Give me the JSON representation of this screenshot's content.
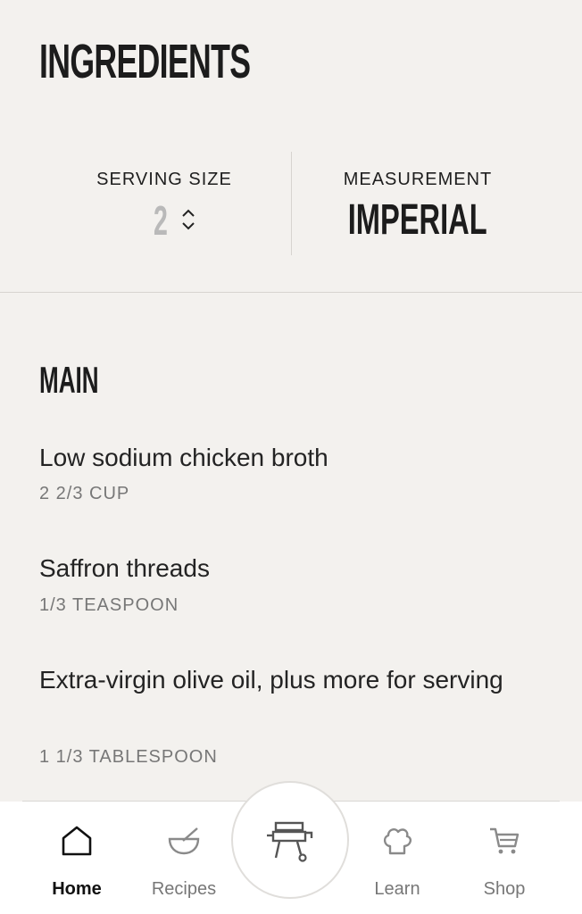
{
  "header": {
    "title": "INGREDIENTS"
  },
  "settings": {
    "serving_size": {
      "label": "SERVING SIZE",
      "value": "2"
    },
    "measurement": {
      "label": "MEASUREMENT",
      "value": "IMPERIAL"
    }
  },
  "section": {
    "title": "MAIN",
    "ingredients": [
      {
        "name": "Low sodium chicken broth",
        "quantity": "2 2/3 CUP"
      },
      {
        "name": "Saffron threads",
        "quantity": "1/3 TEASPOON"
      },
      {
        "name": "Extra-virgin olive oil, plus more for serving",
        "quantity": "1 1/3 TABLESPOON"
      }
    ]
  },
  "nav": {
    "items": [
      {
        "label": "Home",
        "icon": "home-icon",
        "active": true
      },
      {
        "label": "Recipes",
        "icon": "bowl-icon",
        "active": false
      },
      {
        "label": "",
        "icon": "grill-icon",
        "active": false
      },
      {
        "label": "Learn",
        "icon": "chef-hat-icon",
        "active": false
      },
      {
        "label": "Shop",
        "icon": "cart-icon",
        "active": false
      }
    ]
  }
}
